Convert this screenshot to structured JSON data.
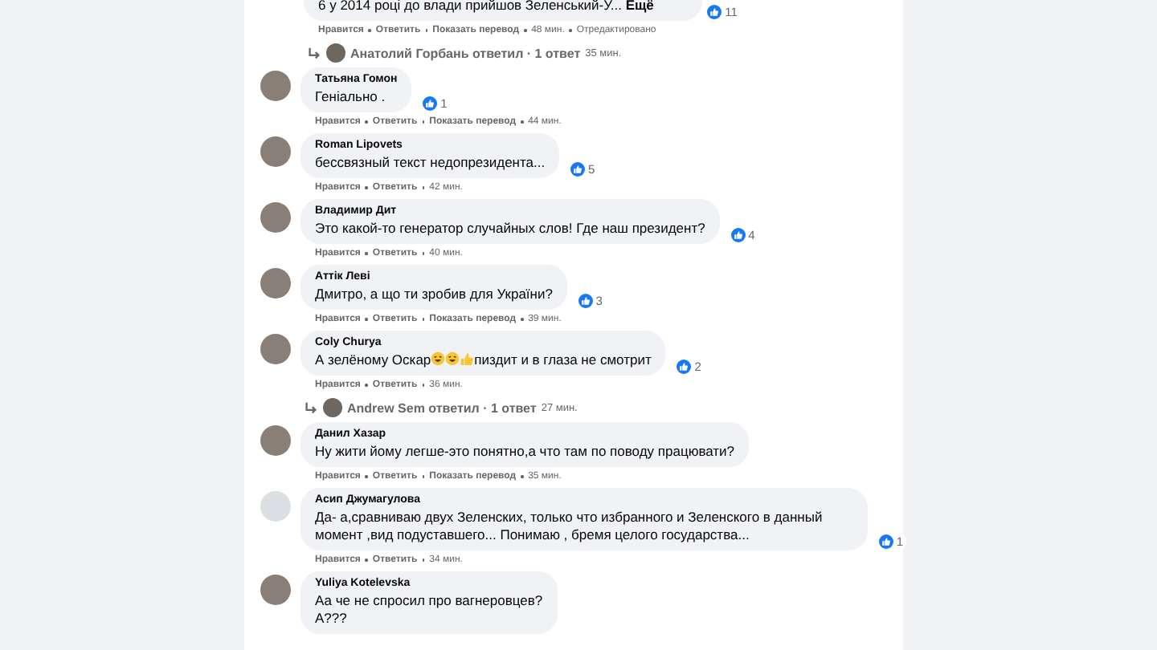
{
  "comments": [
    {
      "lines": [
        "6 у 2014 році до влади прийшов Зеленський-У... **Ещё**"
      ],
      "reactions": "11",
      "actions": [
        "Нравится",
        "Ответить",
        "Показать перевод"
      ],
      "time": "48 мин.",
      "edited": "Отредактировано",
      "reply_summary": {
        "text": "Анатолий Горбань ответил · 1 ответ",
        "time": "35 мин."
      }
    },
    {
      "author": "Татьяна Гомон",
      "lines": [
        "Геніально ."
      ],
      "reactions": "1",
      "actions": [
        "Нравится",
        "Ответить",
        "Показать перевод"
      ],
      "time": "44 мин."
    },
    {
      "author": "Roman Lipovets",
      "lines": [
        "бессвязный текст недопрезидента..."
      ],
      "reactions": "5",
      "actions": [
        "Нравится",
        "Ответить"
      ],
      "time": "42 мин."
    },
    {
      "author": "Владимир Дит",
      "lines": [
        "Это какой-то генератор случайных слов! Где наш президент?"
      ],
      "reactions": "4",
      "actions": [
        "Нравится",
        "Ответить"
      ],
      "time": "40 мин."
    },
    {
      "author": "Аттік Леві",
      "lines": [
        "Дмитро, а що ти зробив для України?"
      ],
      "reactions": "3",
      "actions": [
        "Нравится",
        "Ответить",
        "Показать перевод"
      ],
      "time": "39 мин."
    },
    {
      "author": "Coly Churya",
      "lines": [
        "А зелёному Оскар"
      ],
      "text_after": "пиздит и в глаза не смотрит",
      "reactions": "2",
      "actions": [
        "Нравится",
        "Ответить"
      ],
      "time": "36 мин.",
      "reply_summary": {
        "text": "Andrew Sem ответил · 1 ответ",
        "time": "27 мин."
      }
    },
    {
      "author": "Данил Хазар",
      "lines": [
        "Ну жити йому легше-это понятно,а что там по поводу працювати?"
      ],
      "actions": [
        "Нравится",
        "Ответить",
        "Показать перевод"
      ],
      "time": "35 мин."
    },
    {
      "author": "Асип Джумагулова",
      "default_avatar": true,
      "lines": [
        "Да- а,сравниваю двух Зеленских, только что избранного и Зеленского в данный момент ,вид подуставшего... Понимаю , бремя целого государства..."
      ],
      "reactions": "1",
      "actions": [
        "Нравится",
        "Ответить"
      ],
      "time": "34 мин."
    },
    {
      "author": "Yuliya Kotelevska",
      "lines": [
        "Аа че не спросил про вагнеровцев?",
        "А???"
      ]
    }
  ]
}
